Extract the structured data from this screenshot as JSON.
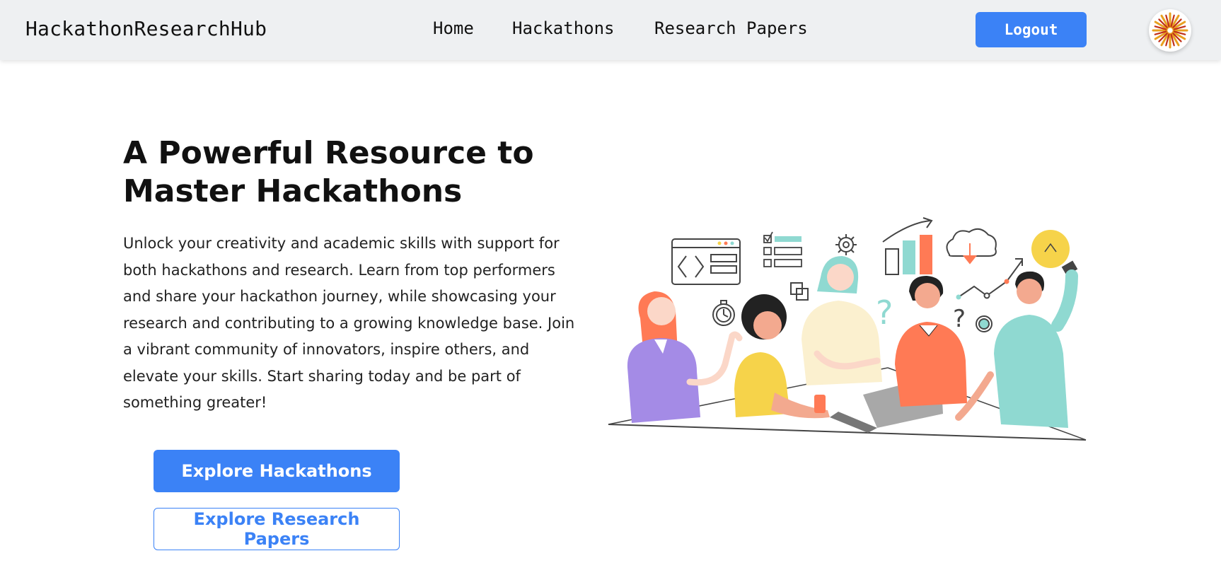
{
  "navbar": {
    "brand": "HackathonResearchHub",
    "links": [
      "Home",
      "Hackathons",
      "Research Papers"
    ],
    "logout_label": "Logout"
  },
  "hero": {
    "title_line1": "A Powerful Resource to",
    "title_line2": "Master Hackathons",
    "description": "Unlock your creativity and academic skills with support for both hackathons and research. Learn from top performers and share your hackathon journey, while showcasing your research and contributing to a growing knowledge base. Join a vibrant community of innovators, inspire others, and elevate your skills. Start sharing today and be part of something greater!",
    "primary_button": "Explore Hackathons",
    "secondary_button": "Explore Research Papers"
  },
  "colors": {
    "accent": "#3b82f6",
    "navbar_bg": "#eef0f2",
    "illustration_purple": "#a48be6",
    "illustration_yellow": "#f6d34a",
    "illustration_orange": "#ff7a55",
    "illustration_teal": "#8fd9d1",
    "illustration_cream": "#fbf0cf"
  },
  "icons": {
    "avatar": "sunburst-avatar-icon"
  }
}
